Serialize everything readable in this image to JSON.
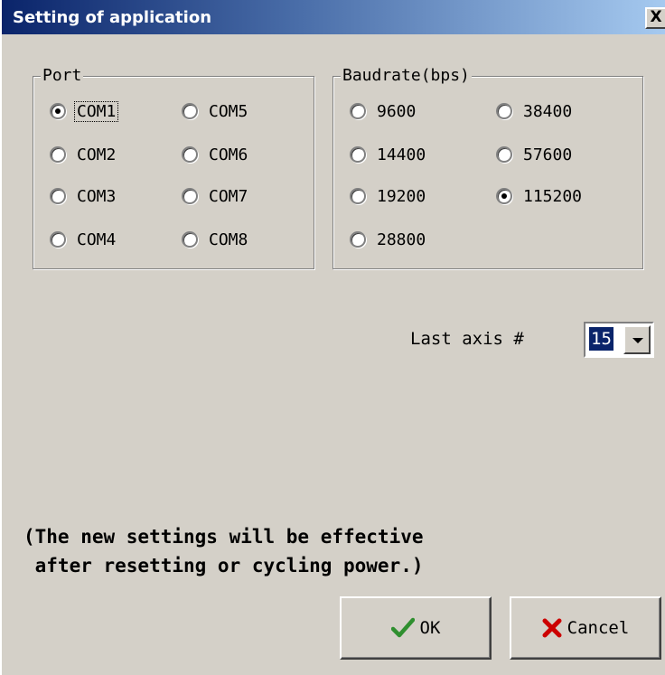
{
  "window": {
    "title": "Setting of application",
    "close_label": "X"
  },
  "port": {
    "legend": "Port",
    "options": [
      "COM1",
      "COM2",
      "COM3",
      "COM4",
      "COM5",
      "COM6",
      "COM7",
      "COM8"
    ],
    "selected": "COM1"
  },
  "baudrate": {
    "legend": "Baudrate(bps)",
    "options": [
      "9600",
      "14400",
      "19200",
      "28800",
      "38400",
      "57600",
      "115200"
    ],
    "selected": "115200"
  },
  "last_axis": {
    "label": "Last axis #",
    "value": "15"
  },
  "notice": {
    "line1": "(The new settings will be effective",
    "line2": " after resetting or cycling power.)"
  },
  "buttons": {
    "ok_label": "OK",
    "cancel_label": "Cancel"
  },
  "icons": {
    "ok": "checkmark-icon",
    "cancel": "x-mark-icon",
    "dropdown": "dropdown-arrow-icon",
    "close": "close-icon"
  },
  "colors": {
    "titlebar": "#0a246a",
    "face": "#d4d0c8",
    "ok_check": "#2f8f2f",
    "cancel_x": "#cc0000"
  }
}
